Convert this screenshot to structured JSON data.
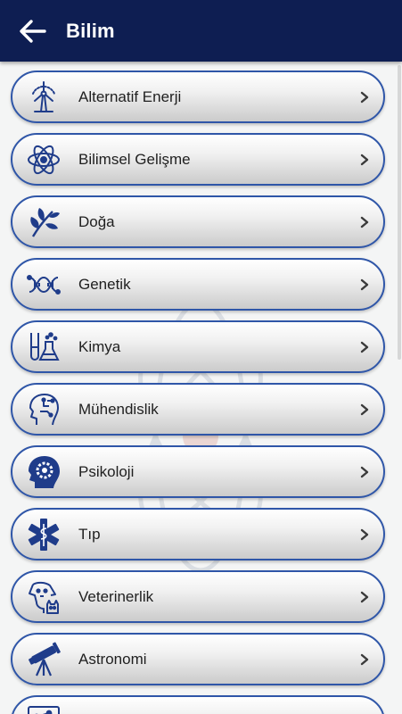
{
  "appbar": {
    "title": "Bilim",
    "back_icon": "arrow-left-icon",
    "background": "#0e1e52"
  },
  "colors": {
    "accent": "#2f56a8",
    "icon": "#1f3c8a",
    "chevron": "#3a3a3a"
  },
  "categories": [
    {
      "label": "Alternatif Enerji",
      "icon": "wind-turbine-icon"
    },
    {
      "label": "Bilimsel Gelişme",
      "icon": "atom-icon"
    },
    {
      "label": "Doğa",
      "icon": "leaf-icon"
    },
    {
      "label": "Genetik",
      "icon": "dna-icon"
    },
    {
      "label": "Kimya",
      "icon": "flask-icon"
    },
    {
      "label": "Mühendislik",
      "icon": "circuit-head-icon"
    },
    {
      "label": "Psikoloji",
      "icon": "gear-head-icon"
    },
    {
      "label": "Tıp",
      "icon": "star-of-life-icon"
    },
    {
      "label": "Veterinerlik",
      "icon": "pets-icon"
    },
    {
      "label": "Astronomi",
      "icon": "telescope-icon"
    },
    {
      "label": "",
      "icon": "network-icon"
    }
  ]
}
